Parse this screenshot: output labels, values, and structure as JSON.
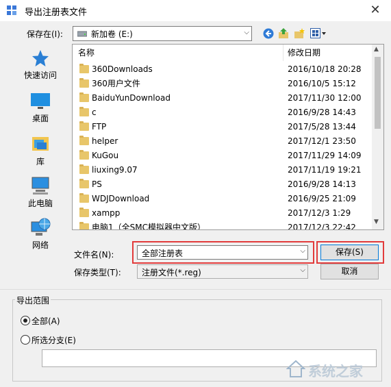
{
  "window": {
    "title": "导出注册表文件",
    "close_glyph": "✕"
  },
  "toolbar": {
    "save_in_label": "保存在(I):",
    "location": "新加卷 (E:)"
  },
  "sidebar": {
    "items": [
      {
        "label": "快速访问",
        "icon": "quick-access-star-icon"
      },
      {
        "label": "桌面",
        "icon": "desktop-icon"
      },
      {
        "label": "库",
        "icon": "library-icon"
      },
      {
        "label": "此电脑",
        "icon": "computer-icon"
      },
      {
        "label": "网络",
        "icon": "network-icon"
      }
    ]
  },
  "filelist": {
    "columns": {
      "name": "名称",
      "date": "修改日期"
    },
    "rows": [
      {
        "name": "360Downloads",
        "date": "2016/10/18 20:28"
      },
      {
        "name": "360用户文件",
        "date": "2016/10/5 15:12"
      },
      {
        "name": "BaiduYunDownload",
        "date": "2017/11/30 12:00"
      },
      {
        "name": "c",
        "date": "2016/9/28 14:43"
      },
      {
        "name": "FTP",
        "date": "2017/5/28 13:44"
      },
      {
        "name": "helper",
        "date": "2017/12/1 23:50"
      },
      {
        "name": "KuGou",
        "date": "2017/11/29 14:09"
      },
      {
        "name": "liuxing9.07",
        "date": "2017/11/19 19:21"
      },
      {
        "name": "PS",
        "date": "2016/9/28 14:13"
      },
      {
        "name": "WDJDownload",
        "date": "2016/9/25 21:09"
      },
      {
        "name": "xampp",
        "date": "2017/12/3 1:29"
      },
      {
        "name": "电脑1（全SMC模拟器中文版）",
        "date": "2017/12/3 22:42"
      }
    ]
  },
  "form": {
    "filename_label": "文件名(N):",
    "filename_value": "全部注册表",
    "filetype_label": "保存类型(T):",
    "filetype_value": "注册文件(*.reg)",
    "save_button": "保存(S)",
    "cancel_button": "取消"
  },
  "export_range": {
    "title": "导出范围",
    "all_label": "全部(A)",
    "selected_label": "所选分支(E)",
    "branch_value": "",
    "selected_option": "all"
  },
  "watermark": "系统之家",
  "colors": {
    "highlight": "#e23b3b",
    "folder": "#e8c66a",
    "accent": "#1e78d6"
  }
}
